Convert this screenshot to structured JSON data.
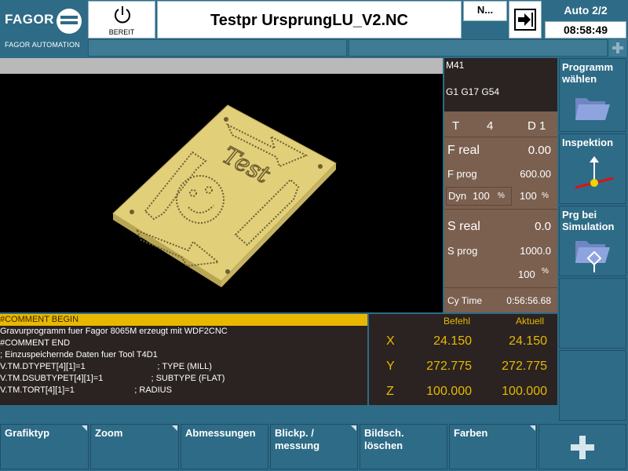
{
  "header": {
    "brand": "FAGOR",
    "brand_sub": "FAGOR AUTOMATION",
    "state_label": "BEREIT",
    "program_title": "Testpr UrsprungLU_V2.NC",
    "n_field": "N...",
    "mode": "Auto 2/2",
    "clock": "08:58:49"
  },
  "status": {
    "m_code": "M41",
    "g_codes": "G1 G17 G54",
    "tool_label": "T",
    "tool_value": "4",
    "d_label": "D 1",
    "f_real_label": "F real",
    "f_real_value": "0.00",
    "f_prog_label": "F prog",
    "f_prog_value": "600.00",
    "dyn_label": "Dyn",
    "dyn_value": "100",
    "dyn_unit": "%",
    "f_override_value": "100",
    "f_override_unit": "%",
    "s_real_label": "S real",
    "s_real_value": "0.0",
    "s_prog_label": "S prog",
    "s_prog_value": "1000.0",
    "s_override_value": "100",
    "s_override_unit": "%",
    "cy_time_label": "Cy Time",
    "cy_time_value": "0:56:56.68"
  },
  "sidebar": {
    "items": [
      {
        "label_line1": "Programm",
        "label_line2": "wählen",
        "icon": "folder-icon"
      },
      {
        "label_line1": "Inspektion",
        "label_line2": "",
        "icon": "inspection-icon"
      },
      {
        "label_line1": "Prg bei",
        "label_line2": "Simulation",
        "icon": "folder-simulation-icon"
      }
    ]
  },
  "program": {
    "lines": [
      "#COMMENT BEGIN",
      "Gravurprogramm fuer Fagor 8065M erzeugt mit WDF2CNC",
      "#COMMENT END",
      "; Einzuspeichernde Daten fuer Tool T4D1",
      "V.TM.DTYPET[4][1]=1                              ; TYPE (MILL)",
      "V.TM.DSUBTYPET[4][1]=1                    ; SUBTYPE (FLAT)",
      "V.TM.TORT[4][1]=1                         ; RADIUS"
    ]
  },
  "coords": {
    "befehl_label": "Befehl",
    "aktuell_label": "Aktuell",
    "axes": [
      {
        "name": "X",
        "befehl": "24.150",
        "aktuell": "24.150"
      },
      {
        "name": "Y",
        "befehl": "272.775",
        "aktuell": "272.775"
      },
      {
        "name": "Z",
        "befehl": "100.000",
        "aktuell": "100.000"
      }
    ]
  },
  "softkeys": [
    {
      "line1": "Grafiktyp",
      "line2": ""
    },
    {
      "line1": "Zoom",
      "line2": ""
    },
    {
      "line1": "Abmessungen",
      "line2": ""
    },
    {
      "line1": "Blickp. /",
      "line2": "messung"
    },
    {
      "line1": "Bildsch.",
      "line2": "löschen"
    },
    {
      "line1": "Farben",
      "line2": ""
    }
  ],
  "colors": {
    "accent_yellow": "#e8b800",
    "panel_blue": "#2e6b86",
    "part_gold": "#e2cf7a"
  }
}
